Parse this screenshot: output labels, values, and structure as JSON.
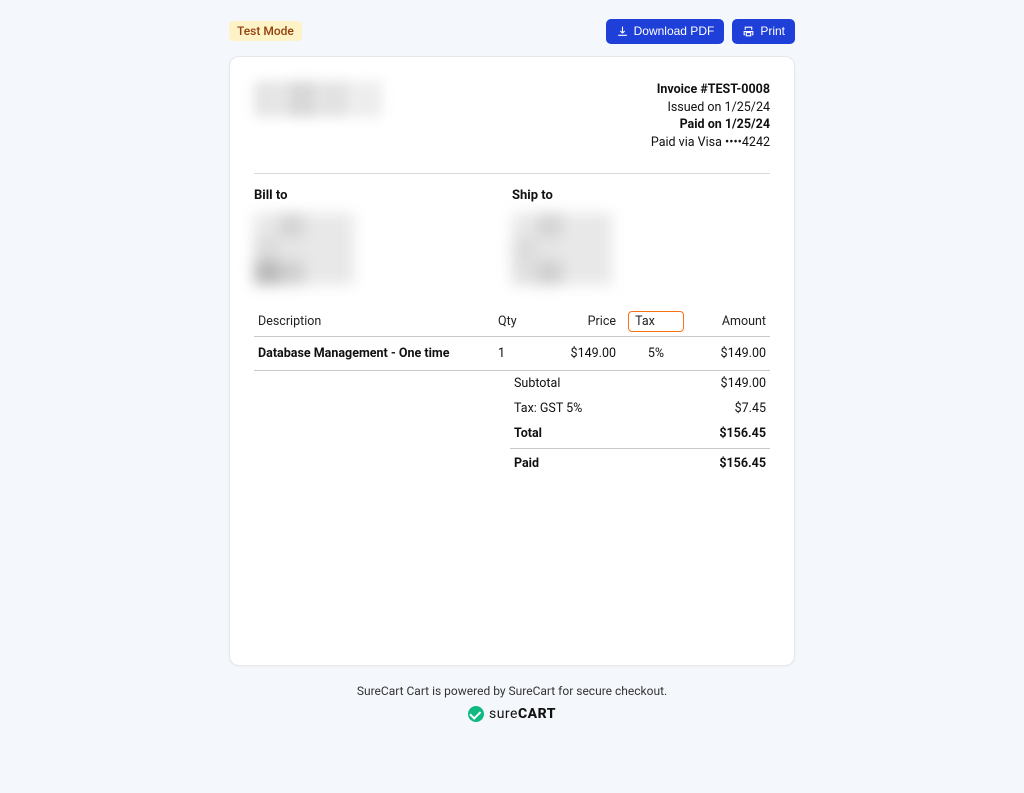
{
  "topbar": {
    "test_mode_label": "Test Mode",
    "download_label": "Download PDF",
    "print_label": "Print"
  },
  "invoice": {
    "number_label": "Invoice #TEST-0008",
    "issued_label": "Issued on 1/25/24",
    "paid_on_label": "Paid on 1/25/24",
    "paid_via_label": "Paid via Visa ••••4242"
  },
  "addresses": {
    "bill_to_label": "Bill to",
    "ship_to_label": "Ship to"
  },
  "table": {
    "headers": {
      "description": "Description",
      "qty": "Qty",
      "price": "Price",
      "tax": "Tax",
      "amount": "Amount"
    },
    "row": {
      "description": "Database Management - One time",
      "qty": "1",
      "price": "$149.00",
      "tax": "5%",
      "amount": "$149.00"
    }
  },
  "totals": {
    "subtotal_label": "Subtotal",
    "subtotal_value": "$149.00",
    "tax_label": "Tax: GST 5%",
    "tax_value": "$7.45",
    "total_label": "Total",
    "total_value": "$156.45",
    "paid_label": "Paid",
    "paid_value": "$156.45"
  },
  "footer": {
    "text": "SureCart Cart is powered by SureCart for secure checkout.",
    "brand_sure": "sure",
    "brand_cart": "CART"
  }
}
